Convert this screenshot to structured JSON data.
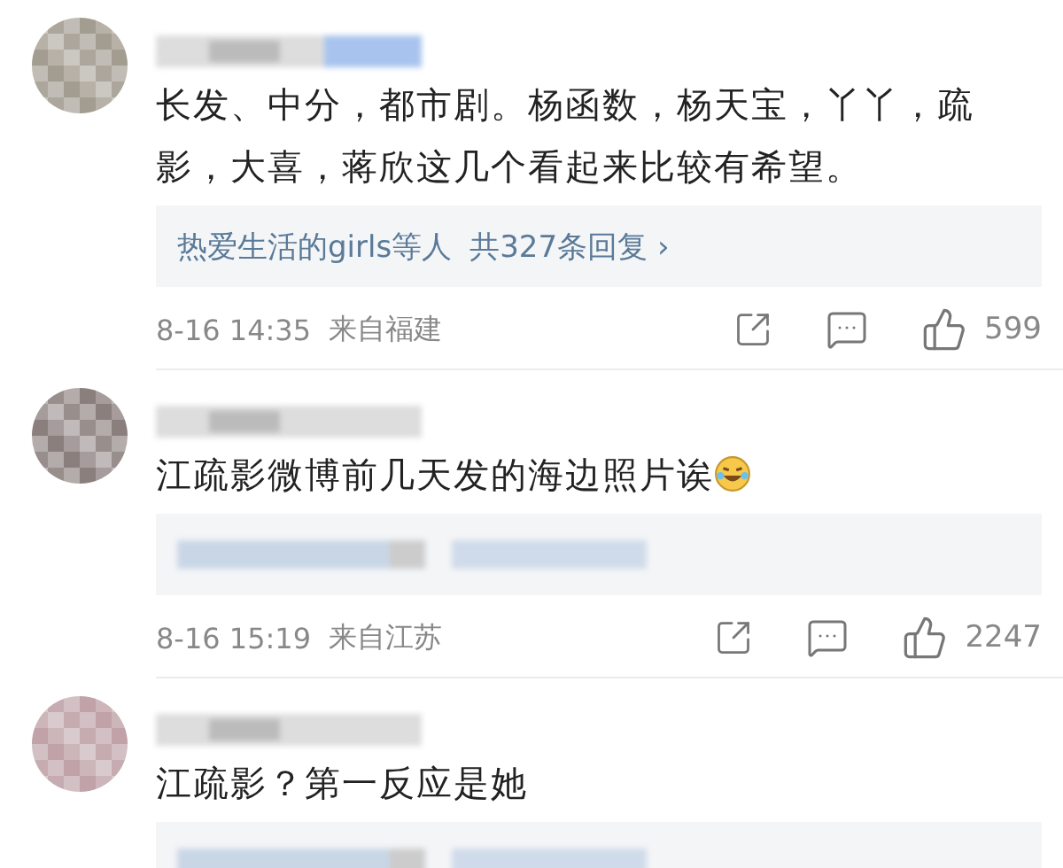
{
  "comments": [
    {
      "text": "长发、中分，都市剧。杨函数，杨天宝，丫丫，疏影，大喜，蒋欣这几个看起来比较有希望。",
      "emoji": false,
      "reply": {
        "kind": "summary",
        "likers": "热爱生活的girls等人",
        "count": "共327条回复",
        "chevron": "›"
      },
      "footer": {
        "time": "8-16 14:35",
        "location": "来自福建",
        "likes": "599"
      }
    },
    {
      "text": "江疏影微博前几天发的海边照片诶",
      "emoji": true,
      "reply": {
        "kind": "blurred"
      },
      "footer": {
        "time": "8-16 15:19",
        "location": "来自江苏",
        "likes": "2247"
      }
    },
    {
      "text": "江疏影？第一反应是她",
      "emoji": false,
      "reply": {
        "kind": "blurred"
      }
    }
  ]
}
